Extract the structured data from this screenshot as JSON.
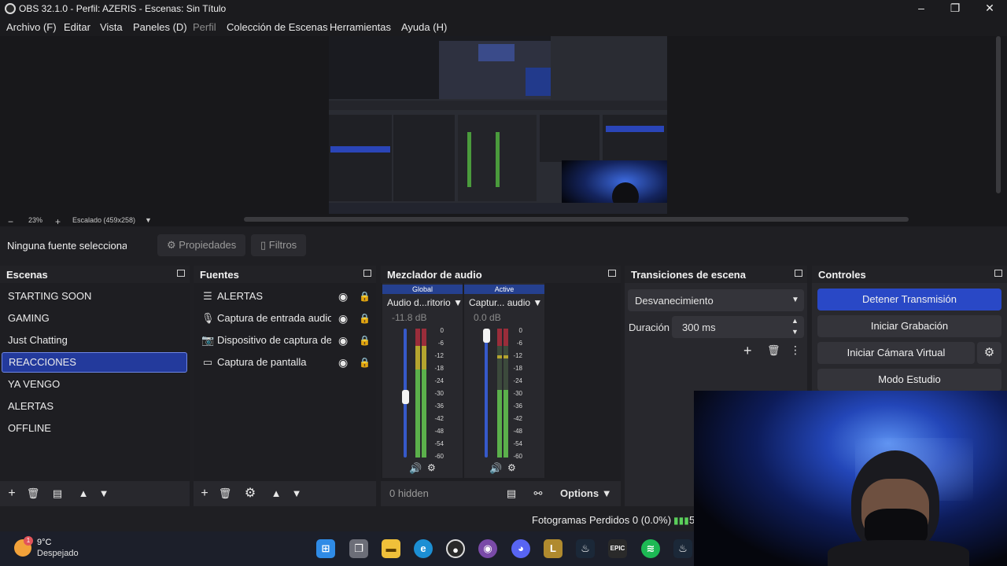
{
  "window": {
    "title": "OBS 32.1.0 - Perfil: AZERIS - Escenas: Sin Título"
  },
  "menu": [
    "Archivo (F)",
    "Editar",
    "Vista",
    "Paneles (D)",
    "Perfil",
    "Colección de Escenas",
    "Herramientas",
    "Ayuda (H)"
  ],
  "preview": {
    "zoom": "23%",
    "scale": "Escalado (459x258)"
  },
  "source_toolbar": {
    "no_source": "Ninguna fuente seleccionad",
    "properties": "Propiedades",
    "filters": "Filtros"
  },
  "scenes": {
    "title": "Escenas",
    "items": [
      "STARTING SOON",
      "GAMING",
      "Just Chatting",
      "REACCIONES",
      "YA VENGO",
      "ALERTAS",
      "OFFLINE"
    ],
    "selected_index": 3
  },
  "sources": {
    "title": "Fuentes",
    "items": [
      {
        "label": "ALERTAS",
        "icon": "list-icon"
      },
      {
        "label": "Captura de entrada audio",
        "icon": "mic-icon"
      },
      {
        "label": "Dispositivo de captura de vídeo",
        "icon": "camera-icon"
      },
      {
        "label": "Captura de pantalla",
        "icon": "monitor-icon"
      }
    ]
  },
  "mixer": {
    "title": "Mezclador de audio",
    "channels": [
      {
        "tag": "Global",
        "name": "Audio d...ritorio",
        "db": "-11.8 dB",
        "level": 0.55
      },
      {
        "tag": "Active",
        "name": "Captur... audio",
        "db": "0.0 dB",
        "level": 0.95
      }
    ],
    "ticks": [
      "0",
      "-6",
      "-12",
      "-18",
      "-24",
      "-30",
      "-36",
      "-42",
      "-48",
      "-54",
      "-60"
    ],
    "hidden": "0 hidden",
    "options": "Options"
  },
  "transitions": {
    "title": "Transiciones de escena",
    "type": "Desvanecimiento",
    "duration_label": "Duración",
    "duration": "300 ms"
  },
  "controls": {
    "title": "Controles",
    "stop_stream": "Detener Transmisión",
    "start_record": "Iniciar Grabación",
    "virtual_cam": "Iniciar Cámara Virtual",
    "studio": "Modo Estudio"
  },
  "status": {
    "dropped": "Fotogramas Perdidos 0 (0.0%)",
    "extra": "5"
  },
  "weather": {
    "temp": "9°C",
    "desc": "Despejado",
    "badge": "1"
  },
  "colors": {
    "accent": "#2948c6",
    "selection": "#233a9c",
    "panel": "#28282d"
  }
}
